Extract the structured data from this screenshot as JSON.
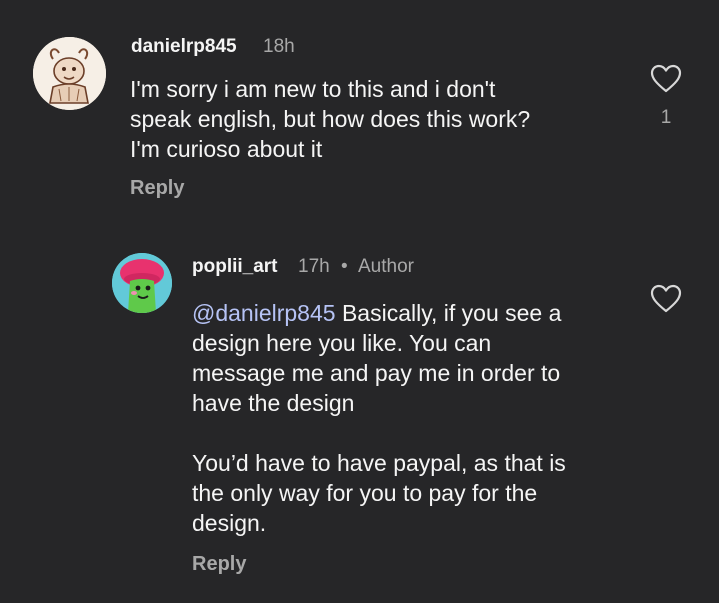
{
  "comments": [
    {
      "username": "danielrp845",
      "time": "18h",
      "text_lines": [
        "I'm sorry i am new to this and i don't",
        "speak english, but how does this work?",
        "I'm curioso about it"
      ],
      "reply_label": "Reply",
      "like_count": "1",
      "avatar_icon": "sketch-animal-avatar"
    },
    {
      "username": "poplii_art",
      "time": "17h",
      "separator": "•",
      "badge": "Author",
      "mention": "@danielrp845",
      "text_first_rest": " Basically, if you see a",
      "text_lines": [
        "design here you like. You can",
        "message me and pay me in order to",
        "have the design"
      ],
      "text_lines_2": [
        "You’d have to have paypal, as that is",
        "the only way for you to pay for the",
        "design."
      ],
      "reply_label": "Reply",
      "avatar_icon": "green-cartoon-avatar"
    }
  ],
  "colors": {
    "background": "#262628",
    "text": "#f5f5f5",
    "muted": "#a8a8a8",
    "mention": "#b6c3f5"
  }
}
